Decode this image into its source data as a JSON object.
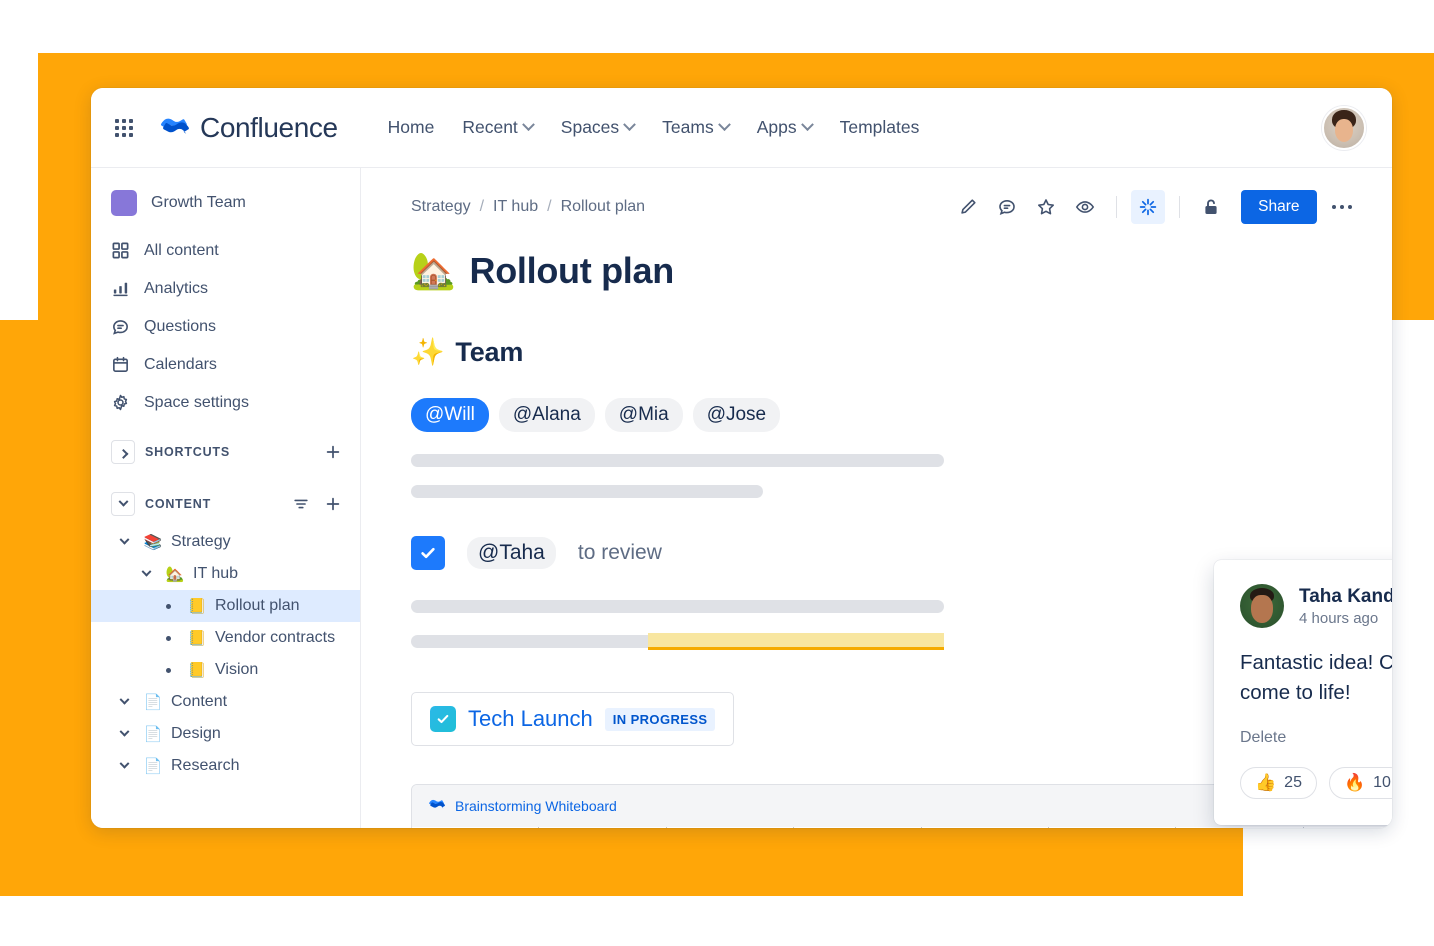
{
  "theme": {
    "accent": "#0C66E4",
    "brand_orange": "#FFA608",
    "purple": "#8777D9",
    "highlight_yellow": "#F8E6A0"
  },
  "topnav": {
    "app_switcher_icon": "grid-apps-icon",
    "logo_icon": "confluence-logo-icon",
    "brand": "Confluence",
    "items": [
      {
        "label": "Home",
        "caret": false
      },
      {
        "label": "Recent",
        "caret": true
      },
      {
        "label": "Spaces",
        "caret": true
      },
      {
        "label": "Teams",
        "caret": true
      },
      {
        "label": "Apps",
        "caret": true
      },
      {
        "label": "Templates",
        "caret": false
      }
    ],
    "avatar_name": "user-avatar"
  },
  "sidebar": {
    "space": {
      "name": "Growth Team",
      "swatch": "#8777D9"
    },
    "items": [
      {
        "label": "All content",
        "icon": "grid-squares-icon"
      },
      {
        "label": "Analytics",
        "icon": "bar-chart-icon"
      },
      {
        "label": "Questions",
        "icon": "chat-bubble-icon"
      },
      {
        "label": "Calendars",
        "icon": "calendar-icon"
      },
      {
        "label": "Space settings",
        "icon": "gear-icon"
      }
    ],
    "shortcuts": {
      "title": "SHORTCUTS",
      "expanded": false,
      "add_icon": "plus-icon"
    },
    "content": {
      "title": "CONTENT",
      "expanded": true,
      "filter_icon": "filter-icon",
      "add_icon": "plus-icon"
    },
    "tree": [
      {
        "label": "Strategy",
        "emoji": "📚",
        "depth": 0,
        "twisty": "down",
        "active": false
      },
      {
        "label": "IT hub",
        "emoji": "🏡",
        "depth": 1,
        "twisty": "down",
        "active": false
      },
      {
        "label": "Rollout plan",
        "emoji": "📒",
        "depth": 2,
        "twisty": "dot",
        "active": true
      },
      {
        "label": "Vendor contracts",
        "emoji": "📒",
        "depth": 2,
        "twisty": "dot",
        "active": false
      },
      {
        "label": "Vision",
        "emoji": "📒",
        "depth": 2,
        "twisty": "dot",
        "active": false
      },
      {
        "label": "Content",
        "emoji": "📄",
        "depth": 0,
        "twisty": "down",
        "active": false
      },
      {
        "label": "Design",
        "emoji": "📄",
        "depth": 0,
        "twisty": "down",
        "active": false
      },
      {
        "label": "Research",
        "emoji": "📄",
        "depth": 0,
        "twisty": "down",
        "active": false
      }
    ]
  },
  "breadcrumb": {
    "items": [
      "Strategy",
      "IT hub",
      "Rollout plan"
    ],
    "separator": "/"
  },
  "toolbar": {
    "edit_icon": "pencil-icon",
    "comment_icon": "comment-icon",
    "star_icon": "star-icon",
    "watch_icon": "eye-icon",
    "ai_icon": "atlassian-intelligence-icon",
    "restrict_icon": "unlock-padlock-icon",
    "share_label": "Share",
    "more_icon": "more-horizontal-icon"
  },
  "page": {
    "title": "Rollout plan",
    "title_emoji": "🏡",
    "section_heading": "Team",
    "section_emoji": "✨",
    "mentions": [
      {
        "label": "@Will",
        "selected": true
      },
      {
        "label": "@Alana",
        "selected": false
      },
      {
        "label": "@Mia",
        "selected": false
      },
      {
        "label": "@Jose",
        "selected": false
      }
    ],
    "task": {
      "checked": true,
      "mention": "@Taha",
      "text": "to review"
    },
    "jira_card": {
      "title": "Tech Launch",
      "status": "IN PROGRESS",
      "icon": "jira-task-icon"
    },
    "whiteboard": {
      "title": "Brainstorming Whiteboard",
      "icon": "confluence-logo-icon",
      "columns": 8
    }
  },
  "comment": {
    "author": "Taha Kandemir",
    "timestamp": "4 hours ago",
    "body": "Fantastic idea! Can’t wait to see this come to life!",
    "delete_label": "Delete",
    "avatar_name": "comment-author-avatar",
    "reactions": [
      {
        "emoji": "👍",
        "count": "25"
      },
      {
        "emoji": "🔥",
        "count": "10"
      }
    ],
    "add_reaction_icon": "add-reaction-icon"
  }
}
